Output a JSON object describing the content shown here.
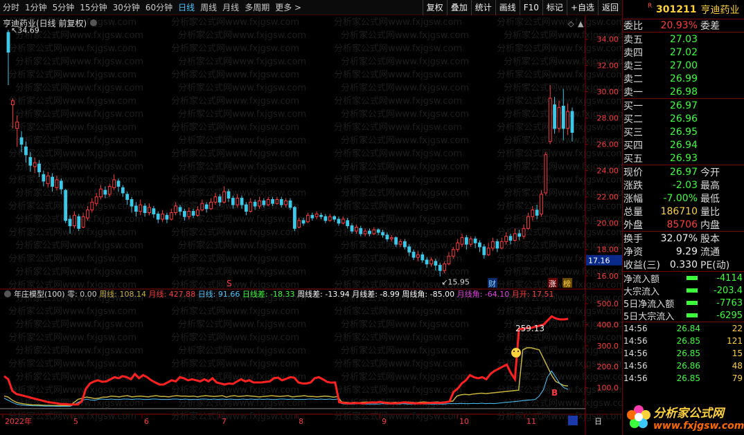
{
  "toolbar": {
    "periods": [
      "分时",
      "1分钟",
      "5分钟",
      "15分钟",
      "30分钟",
      "60分钟",
      "日线",
      "周线",
      "月线",
      "多周期",
      "更多 >"
    ],
    "active_period": "日线",
    "buttons": [
      "复权",
      "叠加",
      "统计",
      "画线",
      "F10",
      "标记",
      "+自选",
      "返回"
    ]
  },
  "main_chart": {
    "title": "亨迪药业(日线 前复权)",
    "high_label": "34.69",
    "low_label": "15.95",
    "current_price_tag": "17.16",
    "marker_s": "S",
    "marker_cai": "财",
    "marker_zhang": "涨",
    "marker_bang": "榜",
    "y_ticks": [
      "34.00",
      "32.00",
      "30.00",
      "28.00",
      "26.00",
      "24.00",
      "22.00",
      "20.00",
      "18.00",
      "16.00"
    ]
  },
  "indicator": {
    "name": "年庄模型(100)",
    "items": [
      {
        "label": "零: 0.00",
        "color": "#c8c8c8"
      },
      {
        "label": "周线: 108.14",
        "color": "#c8b43c"
      },
      {
        "label": "月线: 427.88",
        "color": "#ff3b3b"
      },
      {
        "label": "日线: 91.66",
        "color": "#4cc6ff"
      },
      {
        "label": "日线差: -18.33",
        "color": "#3cff3c"
      },
      {
        "label": "周线差: -13.94",
        "color": "#ffffff"
      },
      {
        "label": "月线差: -8.99",
        "color": "#ffffff"
      },
      {
        "label": "周线角: -85.00",
        "color": "#ffffff"
      },
      {
        "label": "月线角: -64.10",
        "color": "#e040e0"
      },
      {
        "label": "月开: 17.51",
        "color": "#ff3b3b"
      }
    ],
    "annotation": "259.13",
    "marker_b": "B",
    "y_ticks": [
      "500.0",
      "400.0",
      "300.0",
      "200.0",
      "100.0"
    ]
  },
  "x_axis": {
    "labels": [
      "2022年",
      "5",
      "6",
      "7",
      "8",
      "9",
      "10",
      "11"
    ],
    "corner": "日"
  },
  "watermark": "分析家公式网www.fxjgsw.com",
  "quote": {
    "r_badge": "R",
    "code": "301211",
    "name": "亨迪药业",
    "weibi_label": "委比",
    "weibi_value": "20.93%",
    "weicha_label": "委差",
    "asks": [
      {
        "label": "卖五",
        "price": "27.03"
      },
      {
        "label": "卖四",
        "price": "27.02"
      },
      {
        "label": "卖三",
        "price": "27.00"
      },
      {
        "label": "卖二",
        "price": "26.99"
      },
      {
        "label": "卖一",
        "price": "26.98"
      }
    ],
    "bids": [
      {
        "label": "买一",
        "price": "26.97"
      },
      {
        "label": "买二",
        "price": "26.96"
      },
      {
        "label": "买三",
        "price": "26.95"
      },
      {
        "label": "买四",
        "price": "26.94"
      },
      {
        "label": "买五",
        "price": "26.93"
      }
    ],
    "stats": [
      {
        "label": "现价",
        "value": "26.97",
        "color": "green",
        "label2": "今开"
      },
      {
        "label": "涨跌",
        "value": "-2.03",
        "color": "green",
        "label2": "最高"
      },
      {
        "label": "涨幅",
        "value": "-7.00%",
        "color": "green",
        "label2": "最低"
      },
      {
        "label": "总量",
        "value": "186710",
        "color": "yellow",
        "label2": "量比"
      },
      {
        "label": "外盘",
        "value": "85706",
        "color": "red",
        "label2": "内盘"
      }
    ],
    "stats2": [
      {
        "label": "换手",
        "value": "32.07%",
        "color": "white",
        "label2": "股本"
      },
      {
        "label": "净资",
        "value": "9.29",
        "color": "white",
        "label2": "流通"
      },
      {
        "label": "收益(三)",
        "value": "0.330",
        "color": "white",
        "label2": "PE(动)"
      }
    ],
    "flows": [
      {
        "label": "净流入额",
        "value": "-4114"
      },
      {
        "label": "大宗流入",
        "value": "-203.4"
      },
      {
        "label": "5日净流入额",
        "value": "-7763"
      },
      {
        "label": "5日大宗流入",
        "value": "-6295"
      }
    ],
    "ticks": [
      {
        "time": "14:56",
        "price": "26.84",
        "vol": "22"
      },
      {
        "time": "14:56",
        "price": "26.85",
        "vol": "121"
      },
      {
        "time": "14:56",
        "price": "26.85",
        "vol": "15"
      },
      {
        "time": "14:56",
        "price": "26.86",
        "vol": "48"
      },
      {
        "time": "14:56",
        "price": "26.85",
        "vol": "79"
      }
    ],
    "logo_cn": "分析家公式网",
    "logo_url": "www.fxjgsw.com"
  },
  "candles": [
    [
      34.5,
      33.0,
      34.69,
      30.5
    ],
    [
      29.0,
      29.3,
      29.5,
      27.2
    ],
    [
      27.2,
      27.7,
      28.2,
      25.8
    ],
    [
      26.5,
      26.0,
      27.0,
      25.4
    ],
    [
      25.8,
      25.2,
      26.2,
      24.6
    ],
    [
      25.0,
      24.4,
      25.4,
      23.9
    ],
    [
      24.3,
      24.6,
      25.0,
      23.8
    ],
    [
      24.5,
      23.9,
      24.8,
      23.5
    ],
    [
      23.7,
      23.2,
      24.0,
      22.8
    ],
    [
      23.0,
      23.6,
      23.9,
      22.7
    ],
    [
      23.5,
      22.8,
      23.8,
      22.4
    ],
    [
      22.7,
      23.3,
      23.6,
      22.5
    ],
    [
      23.2,
      22.6,
      23.4,
      22.2
    ],
    [
      22.5,
      20.2,
      22.6,
      20.0
    ],
    [
      20.3,
      19.8,
      20.6,
      19.2
    ],
    [
      19.8,
      20.6,
      20.9,
      19.6
    ],
    [
      20.5,
      19.6,
      20.7,
      19.4
    ],
    [
      19.7,
      20.5,
      20.8,
      19.6
    ],
    [
      20.4,
      21.0,
      21.3,
      20.2
    ],
    [
      21.0,
      21.6,
      21.9,
      20.8
    ],
    [
      21.5,
      22.0,
      22.3,
      21.3
    ],
    [
      22.0,
      22.6,
      22.9,
      21.8
    ],
    [
      22.5,
      22.2,
      22.8,
      21.9
    ],
    [
      22.2,
      22.8,
      23.0,
      22.0
    ],
    [
      22.7,
      23.3,
      23.7,
      22.5
    ],
    [
      23.2,
      22.8,
      23.4,
      22.4
    ],
    [
      22.7,
      22.3,
      22.9,
      22.0
    ],
    [
      22.2,
      21.8,
      22.4,
      21.4
    ],
    [
      21.8,
      21.3,
      22.0,
      20.8
    ],
    [
      21.3,
      20.9,
      21.6,
      20.5
    ],
    [
      20.9,
      21.4,
      21.8,
      20.6
    ],
    [
      21.3,
      20.8,
      21.5,
      20.5
    ],
    [
      20.8,
      21.2,
      21.5,
      20.6
    ],
    [
      21.1,
      20.7,
      21.3,
      20.4
    ],
    [
      20.7,
      20.3,
      20.9,
      20.0
    ],
    [
      20.3,
      20.7,
      21.0,
      20.1
    ],
    [
      20.6,
      20.3,
      20.8,
      20.0
    ],
    [
      20.3,
      20.8,
      21.1,
      20.2
    ],
    [
      20.8,
      21.3,
      21.6,
      20.6
    ],
    [
      21.2,
      20.9,
      21.4,
      20.6
    ],
    [
      20.9,
      20.5,
      21.1,
      20.2
    ],
    [
      20.5,
      20.9,
      21.2,
      20.3
    ],
    [
      20.9,
      20.6,
      21.1,
      20.4
    ],
    [
      20.6,
      21.0,
      21.3,
      20.5
    ],
    [
      21.0,
      21.5,
      21.8,
      20.9
    ],
    [
      21.4,
      21.1,
      21.6,
      20.8
    ],
    [
      21.1,
      21.6,
      21.9,
      21.0
    ],
    [
      21.6,
      22.0,
      22.3,
      21.4
    ],
    [
      22.0,
      21.6,
      22.2,
      21.3
    ],
    [
      21.6,
      22.4,
      22.8,
      21.5
    ],
    [
      22.4,
      21.9,
      22.6,
      21.6
    ],
    [
      21.9,
      21.4,
      22.1,
      21.1
    ],
    [
      21.4,
      21.9,
      22.2,
      21.2
    ],
    [
      21.9,
      21.4,
      22.1,
      21.1
    ],
    [
      21.4,
      20.9,
      21.6,
      20.6
    ],
    [
      20.9,
      21.6,
      21.9,
      20.8
    ],
    [
      21.6,
      21.3,
      21.8,
      21.0
    ],
    [
      21.3,
      21.7,
      22.0,
      21.1
    ],
    [
      21.7,
      21.4,
      21.9,
      21.2
    ],
    [
      21.4,
      21.8,
      22.0,
      21.3
    ],
    [
      21.8,
      21.5,
      22.0,
      21.3
    ],
    [
      21.5,
      21.8,
      22.0,
      21.4
    ],
    [
      21.8,
      21.4,
      22.0,
      21.2
    ],
    [
      21.4,
      21.7,
      21.9,
      21.2
    ],
    [
      21.7,
      21.2,
      21.9,
      21.0
    ],
    [
      21.2,
      19.6,
      21.3,
      19.4
    ],
    [
      19.7,
      20.2,
      20.4,
      19.6
    ],
    [
      20.2,
      20.0,
      20.4,
      19.8
    ],
    [
      20.1,
      20.6,
      20.8,
      20.0
    ],
    [
      20.6,
      20.4,
      20.8,
      20.2
    ],
    [
      20.5,
      20.7,
      20.9,
      20.3
    ],
    [
      20.6,
      20.5,
      20.8,
      20.3
    ],
    [
      20.5,
      20.2,
      20.7,
      20.0
    ],
    [
      20.2,
      20.5,
      20.7,
      20.1
    ],
    [
      20.5,
      20.3,
      20.6,
      20.1
    ],
    [
      20.3,
      20.0,
      20.5,
      19.8
    ],
    [
      20.0,
      20.3,
      20.5,
      19.9
    ],
    [
      20.2,
      19.8,
      20.4,
      19.6
    ],
    [
      19.8,
      19.4,
      20.0,
      19.2
    ],
    [
      19.4,
      19.7,
      19.9,
      19.2
    ],
    [
      19.6,
      19.2,
      19.8,
      19.0
    ],
    [
      19.2,
      19.4,
      19.6,
      19.0
    ],
    [
      19.4,
      19.2,
      19.6,
      19.0
    ],
    [
      19.2,
      19.5,
      19.7,
      19.1
    ],
    [
      19.5,
      19.3,
      19.6,
      19.1
    ],
    [
      19.3,
      19.1,
      19.5,
      18.9
    ],
    [
      19.1,
      18.8,
      19.3,
      18.6
    ],
    [
      18.8,
      18.9,
      19.1,
      18.6
    ],
    [
      18.9,
      18.4,
      19.0,
      18.2
    ],
    [
      18.4,
      18.6,
      18.8,
      18.2
    ],
    [
      18.6,
      18.2,
      18.8,
      18.0
    ],
    [
      18.2,
      17.8,
      18.4,
      17.5
    ],
    [
      17.8,
      17.4,
      18.0,
      17.2
    ],
    [
      17.4,
      17.6,
      17.9,
      17.1
    ],
    [
      17.6,
      17.2,
      17.8,
      17.0
    ],
    [
      17.2,
      16.9,
      17.4,
      16.6
    ],
    [
      16.9,
      17.2,
      17.4,
      16.7
    ],
    [
      17.1,
      16.8,
      17.3,
      16.4
    ],
    [
      16.8,
      16.4,
      17.0,
      15.95
    ],
    [
      16.4,
      16.9,
      17.1,
      16.2
    ],
    [
      16.9,
      17.5,
      17.8,
      16.8
    ],
    [
      17.5,
      18.0,
      18.2,
      17.3
    ],
    [
      18.0,
      18.5,
      18.8,
      17.8
    ],
    [
      18.4,
      18.9,
      19.2,
      18.2
    ],
    [
      18.9,
      18.4,
      19.1,
      18.0
    ],
    [
      18.4,
      18.8,
      19.0,
      18.2
    ],
    [
      18.8,
      18.5,
      19.0,
      18.1
    ],
    [
      18.5,
      18.2,
      18.7,
      17.8
    ],
    [
      18.2,
      17.6,
      18.4,
      17.3
    ],
    [
      17.6,
      18.1,
      18.5,
      17.5
    ],
    [
      18.1,
      18.6,
      18.9,
      17.9
    ],
    [
      18.6,
      18.1,
      18.8,
      17.8
    ],
    [
      18.1,
      18.6,
      18.9,
      18.0
    ],
    [
      18.6,
      19.0,
      19.3,
      18.4
    ],
    [
      19.0,
      18.7,
      19.2,
      18.4
    ],
    [
      18.7,
      19.2,
      19.6,
      18.6
    ],
    [
      19.2,
      19.0,
      19.5,
      18.7
    ],
    [
      19.0,
      19.6,
      19.9,
      18.8
    ],
    [
      19.6,
      20.5,
      20.8,
      19.5
    ],
    [
      20.5,
      21.0,
      21.3,
      20.2
    ],
    [
      21.0,
      20.6,
      21.4,
      20.3
    ],
    [
      20.7,
      22.2,
      22.5,
      20.5
    ],
    [
      22.3,
      25.2,
      25.4,
      22.1
    ],
    [
      26.2,
      29.5,
      30.5,
      26.0
    ],
    [
      29.0,
      27.2,
      29.6,
      26.8
    ],
    [
      27.2,
      28.8,
      29.3,
      26.9
    ],
    [
      28.9,
      27.2,
      30.2,
      26.3
    ],
    [
      27.2,
      28.5,
      29.1,
      26.7
    ],
    [
      28.5,
      26.9,
      28.8,
      26.2
    ]
  ],
  "ind_month": [
    155,
    140,
    85,
    70,
    65,
    60,
    55,
    50,
    45,
    40,
    35,
    30,
    28,
    25,
    22,
    22,
    20,
    20,
    20,
    35,
    95,
    120,
    130,
    135,
    128,
    130,
    140,
    150,
    145,
    155,
    150,
    140,
    165,
    145,
    160,
    150,
    135,
    125,
    115,
    115,
    125,
    135,
    130,
    150,
    145,
    135,
    140,
    135,
    130,
    140,
    130,
    145,
    125,
    120,
    115,
    120,
    118,
    130,
    140,
    130,
    135,
    125,
    125,
    125,
    128,
    130,
    145,
    148,
    135,
    142,
    150,
    148,
    125,
    120,
    120,
    125,
    145,
    150,
    140,
    128,
    124,
    125,
    30,
    28,
    25,
    26,
    27,
    26,
    25,
    28,
    30,
    29,
    32,
    28,
    26,
    25,
    26,
    28,
    30,
    28,
    26,
    25,
    25,
    26,
    27,
    28,
    27,
    28,
    30,
    35,
    80,
    95,
    120,
    135,
    160,
    150,
    145,
    150,
    140,
    165,
    180,
    190,
    200,
    210,
    170,
    140,
    380,
    380,
    385,
    385,
    390,
    395,
    400,
    420,
    440,
    430,
    425,
    425,
    428
  ],
  "ind_week": [
    60,
    55,
    40,
    30,
    25,
    22,
    20,
    18,
    18,
    17,
    16,
    16,
    15,
    15,
    15,
    15,
    15,
    30,
    45,
    50,
    55,
    52,
    48,
    50,
    55,
    55,
    60,
    58,
    56,
    60,
    62,
    56,
    58,
    60,
    58,
    56,
    60,
    62,
    58,
    58,
    56,
    60,
    62,
    60,
    60,
    58,
    60,
    56,
    60,
    62,
    60,
    58,
    60,
    62,
    55,
    60,
    62,
    58,
    60,
    62,
    60,
    58,
    56,
    58,
    60,
    62,
    60,
    58,
    60,
    62,
    56,
    58,
    60,
    62,
    58,
    58,
    56,
    58,
    60,
    58,
    55,
    58,
    32,
    30,
    28,
    30,
    28,
    30,
    32,
    30,
    28,
    30,
    32,
    30,
    28,
    30,
    28,
    30,
    32,
    30,
    28,
    30,
    32,
    30,
    30,
    32,
    30,
    32,
    34,
    36,
    60,
    66,
    68,
    66,
    70,
    72,
    74,
    72,
    74,
    76,
    78,
    80,
    82,
    84,
    86,
    88,
    280,
    290,
    290,
    285,
    280,
    240,
    200,
    160,
    130,
    120,
    110,
    108
  ],
  "ind_day": [
    50,
    40,
    30,
    22,
    18,
    16,
    15,
    14,
    14,
    13,
    12,
    12,
    12,
    11,
    11,
    11,
    11,
    20,
    30,
    40,
    45,
    42,
    40,
    45,
    46,
    44,
    46,
    44,
    44,
    46,
    46,
    44,
    46,
    46,
    44,
    44,
    46,
    46,
    44,
    44,
    44,
    46,
    46,
    44,
    46,
    44,
    44,
    44,
    46,
    46,
    44,
    46,
    44,
    46,
    44,
    46,
    44,
    44,
    46,
    44,
    46,
    44,
    46,
    44,
    46,
    44,
    44,
    46,
    46,
    44,
    46,
    44,
    44,
    44,
    46,
    46,
    44,
    46,
    44,
    46,
    44,
    46,
    24,
    22,
    22,
    22,
    24,
    22,
    22,
    22,
    22,
    22,
    24,
    22,
    22,
    22,
    22,
    24,
    22,
    22,
    22,
    24,
    22,
    22,
    22,
    22,
    22,
    22,
    24,
    24,
    24,
    25,
    24,
    24,
    25,
    24,
    26,
    24,
    25,
    24,
    26,
    28,
    30,
    32,
    34,
    36,
    38,
    40,
    42,
    44,
    60,
    90,
    150,
    180,
    150,
    120,
    100,
    92
  ]
}
